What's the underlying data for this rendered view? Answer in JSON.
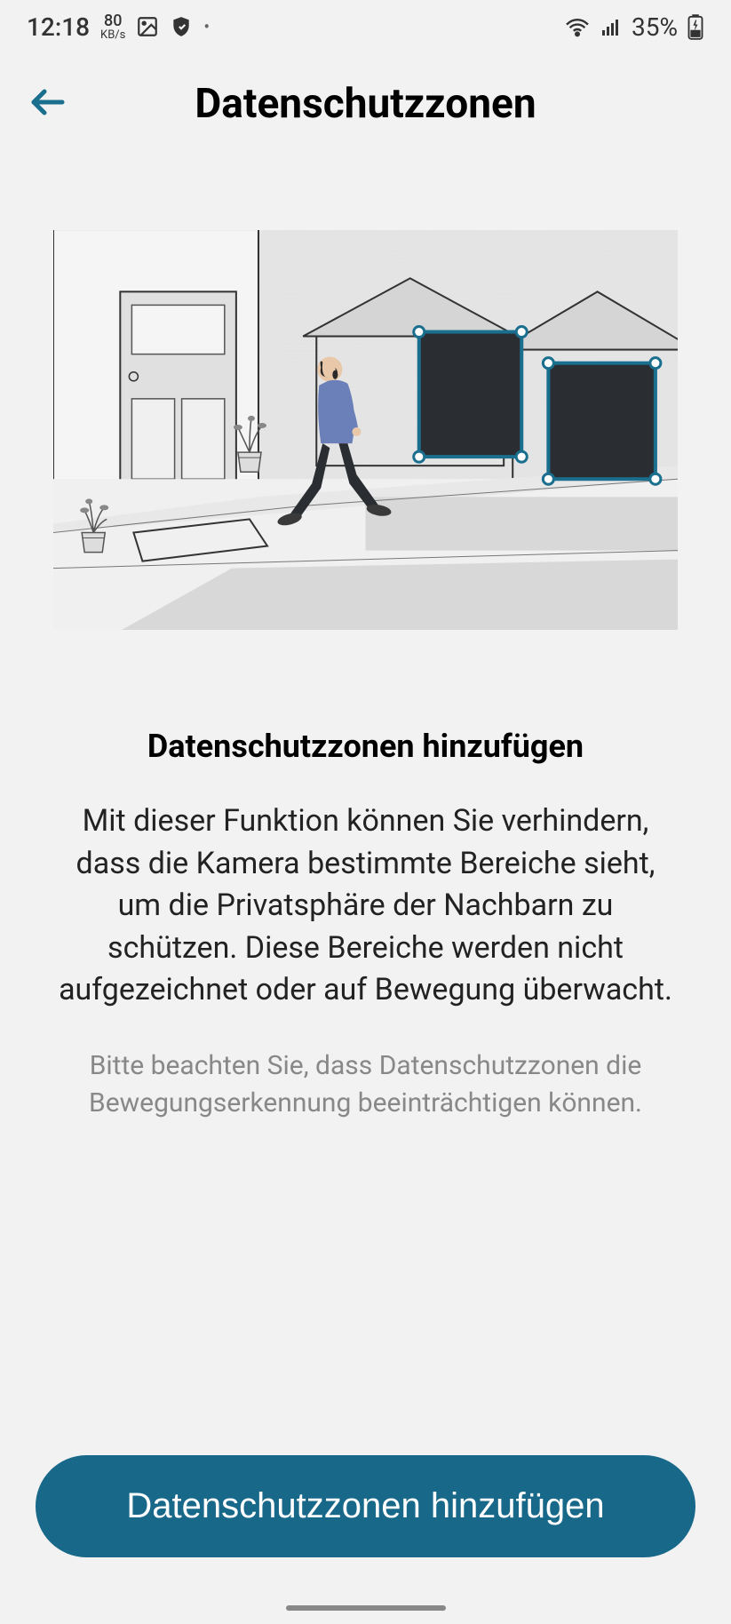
{
  "status": {
    "time": "12:18",
    "speed_value": "80",
    "speed_unit": "KB/s",
    "battery": "35%"
  },
  "header": {
    "title": "Datenschutzzonen"
  },
  "content": {
    "heading": "Datenschutzzonen hinzufügen",
    "body": "Mit dieser Funktion können Sie verhindern, dass die Kamera bestimmte Bereiche sieht, um die Privatsphäre der Nachbarn zu schützen. Diese Bereiche werden nicht aufgezeichnet oder auf Bewegung überwacht.",
    "note": "Bitte beachten Sie, dass Datenschutzzonen die Bewegungserkennung beeinträchtigen können."
  },
  "button": {
    "label": "Datenschutzzonen hinzufügen"
  }
}
